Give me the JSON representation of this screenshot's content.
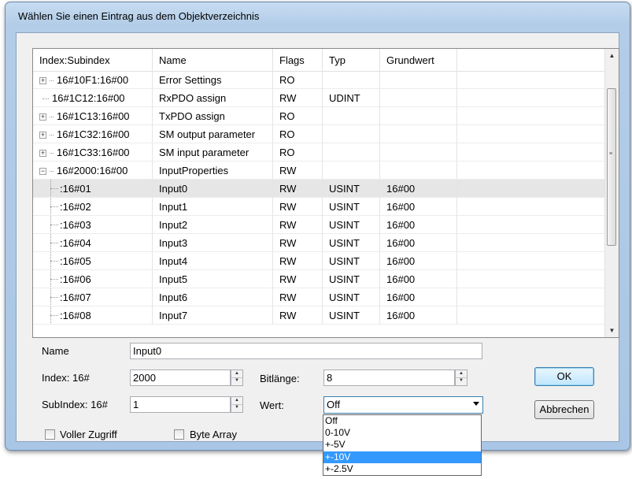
{
  "window": {
    "title": "Wählen Sie einen Eintrag aus dem Objektverzeichnis"
  },
  "table": {
    "columns": [
      "Index:Subindex",
      "Name",
      "Flags",
      "Typ",
      "Grundwert"
    ],
    "rows": [
      {
        "index": "16#10F1:16#00",
        "name": "Error Settings",
        "flags": "RO",
        "typ": "",
        "grundwert": "",
        "node": "collapsed"
      },
      {
        "index": "16#1C12:16#00",
        "name": "RxPDO assign",
        "flags": "RW",
        "typ": "UDINT",
        "grundwert": "",
        "node": "leaf"
      },
      {
        "index": "16#1C13:16#00",
        "name": "TxPDO assign",
        "flags": "RO",
        "typ": "",
        "grundwert": "",
        "node": "collapsed"
      },
      {
        "index": "16#1C32:16#00",
        "name": "SM output parameter",
        "flags": "RO",
        "typ": "",
        "grundwert": "",
        "node": "collapsed"
      },
      {
        "index": "16#1C33:16#00",
        "name": "SM input parameter",
        "flags": "RO",
        "typ": "",
        "grundwert": "",
        "node": "collapsed"
      },
      {
        "index": "16#2000:16#00",
        "name": "InputProperties",
        "flags": "RW",
        "typ": "",
        "grundwert": "",
        "node": "expanded"
      },
      {
        "index": ":16#01",
        "name": "Input0",
        "flags": "RW",
        "typ": "USINT",
        "grundwert": "16#00",
        "node": "child",
        "selected": true
      },
      {
        "index": ":16#02",
        "name": "Input1",
        "flags": "RW",
        "typ": "USINT",
        "grundwert": "16#00",
        "node": "child"
      },
      {
        "index": ":16#03",
        "name": "Input2",
        "flags": "RW",
        "typ": "USINT",
        "grundwert": "16#00",
        "node": "child"
      },
      {
        "index": ":16#04",
        "name": "Input3",
        "flags": "RW",
        "typ": "USINT",
        "grundwert": "16#00",
        "node": "child"
      },
      {
        "index": ":16#05",
        "name": "Input4",
        "flags": "RW",
        "typ": "USINT",
        "grundwert": "16#00",
        "node": "child"
      },
      {
        "index": ":16#06",
        "name": "Input5",
        "flags": "RW",
        "typ": "USINT",
        "grundwert": "16#00",
        "node": "child"
      },
      {
        "index": ":16#07",
        "name": "Input6",
        "flags": "RW",
        "typ": "USINT",
        "grundwert": "16#00",
        "node": "child"
      },
      {
        "index": ":16#08",
        "name": "Input7",
        "flags": "RW",
        "typ": "USINT",
        "grundwert": "16#00",
        "node": "child"
      }
    ]
  },
  "form": {
    "name_label": "Name",
    "name_value": "Input0",
    "index_label": "Index: 16#",
    "index_value": "2000",
    "subindex_label": "SubIndex: 16#",
    "subindex_value": "1",
    "bitlaenge_label": "Bitlänge:",
    "bitlaenge_value": "8",
    "wert_label": "Wert:",
    "wert_value": "Off",
    "wert_options": [
      "Off",
      "0-10V",
      "+-5V",
      "+-10V",
      "+-2.5V"
    ],
    "wert_highlighted": "+-10V",
    "voller_zugriff_label": "Voller Zugriff",
    "byte_array_label": "Byte Array"
  },
  "buttons": {
    "ok": "OK",
    "abbrechen": "Abbrechen"
  },
  "icons": {
    "expand": "plus-box-icon",
    "collapse": "minus-box-icon",
    "scroll_up": "triangle-up-icon",
    "scroll_down": "triangle-down-icon",
    "combo_arrow": "triangle-down-icon"
  },
  "colors": {
    "title_bar": "#b3cde8",
    "selection_highlight": "#3399ff",
    "selected_row": "#e6e6e6"
  }
}
